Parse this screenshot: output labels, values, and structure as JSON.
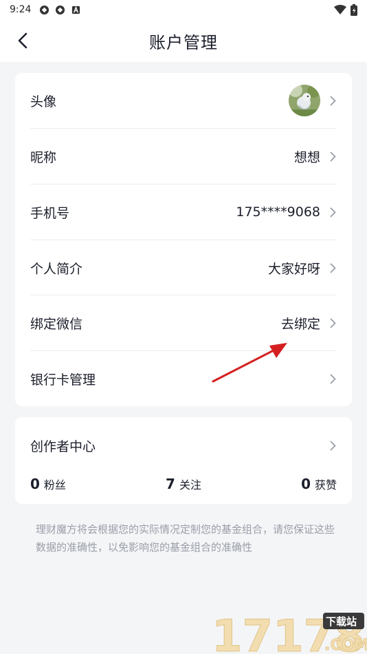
{
  "status_bar": {
    "time": "9:24"
  },
  "header": {
    "title": "账户管理"
  },
  "profile": {
    "rows": [
      {
        "label": "头像",
        "value": ""
      },
      {
        "label": "昵称",
        "value": "想想"
      },
      {
        "label": "手机号",
        "value": "175****9068"
      },
      {
        "label": "个人简介",
        "value": "大家好呀"
      },
      {
        "label": "绑定微信",
        "value": "去绑定"
      },
      {
        "label": "银行卡管理",
        "value": ""
      }
    ]
  },
  "creator": {
    "label": "创作者中心",
    "stats": [
      {
        "num": "0",
        "label": "粉丝"
      },
      {
        "num": "7",
        "label": "关注"
      },
      {
        "num": "0",
        "label": "获赞"
      }
    ]
  },
  "note": "理财魔方将会根据您的实际情况定制您的基金组合，请您保证这些数据的准确性，以免影响您的基金组合的准确性",
  "watermark": {
    "digits": "17178",
    "badge": "下载站",
    "suffix": ".COM"
  },
  "colors": {
    "background": "#f4f5f7",
    "card": "#ffffff",
    "text": "#1b1f2b",
    "muted": "#9a9ea8",
    "annotation_arrow": "#d42020"
  }
}
